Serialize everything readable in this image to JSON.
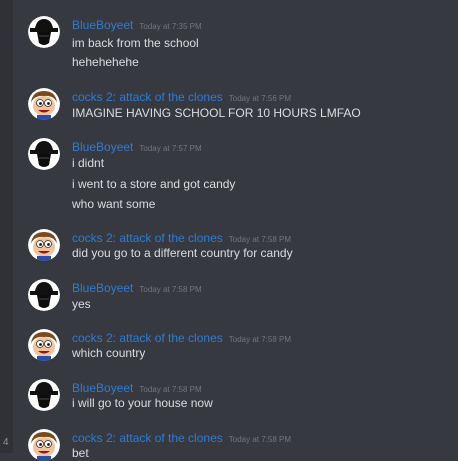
{
  "messages": [
    {
      "author": "BlueBoyeet",
      "avatar": "hat-avatar-icon",
      "time": "Today at 7:35 PM",
      "lines": [
        "im back from the school",
        "hehehehehe"
      ]
    },
    {
      "author": "cocks 2: attack of the clones",
      "avatar": "cartoon-face-avatar-icon",
      "time": "Today at 7:56 PM",
      "lines": [
        "IMAGINE HAVING SCHOOL FOR 10 HOURS LMFAO"
      ]
    },
    {
      "author": "BlueBoyeet",
      "avatar": "hat-avatar-icon",
      "time": "Today at 7:57 PM",
      "lines": [
        "i didnt",
        "i went to a store and got candy",
        "who want some"
      ]
    },
    {
      "author": "cocks 2: attack of the clones",
      "avatar": "cartoon-face-avatar-icon",
      "time": "Today at 7:58 PM",
      "lines": [
        "did you go to a different country for candy"
      ]
    },
    {
      "author": "BlueBoyeet",
      "avatar": "hat-avatar-icon",
      "time": "Today at 7:58 PM",
      "lines": [
        "yes"
      ]
    },
    {
      "author": "cocks 2: attack of the clones",
      "avatar": "cartoon-face-avatar-icon",
      "time": "Today at 7:58 PM",
      "lines": [
        "which country"
      ]
    },
    {
      "author": "BlueBoyeet",
      "avatar": "hat-avatar-icon",
      "time": "Today at 7:58 PM",
      "lines": [
        "i will go to your house now"
      ]
    },
    {
      "author": "cocks 2: attack of the clones",
      "avatar": "cartoon-face-avatar-icon",
      "time": "Today at 7:58 PM",
      "lines": [
        "bet"
      ]
    }
  ],
  "sidebar": {
    "glyph": "4"
  },
  "colors": {
    "background": "#36393f",
    "username": "#2e7bd6",
    "text": "#dcddde",
    "timestamp": "#72767d"
  }
}
